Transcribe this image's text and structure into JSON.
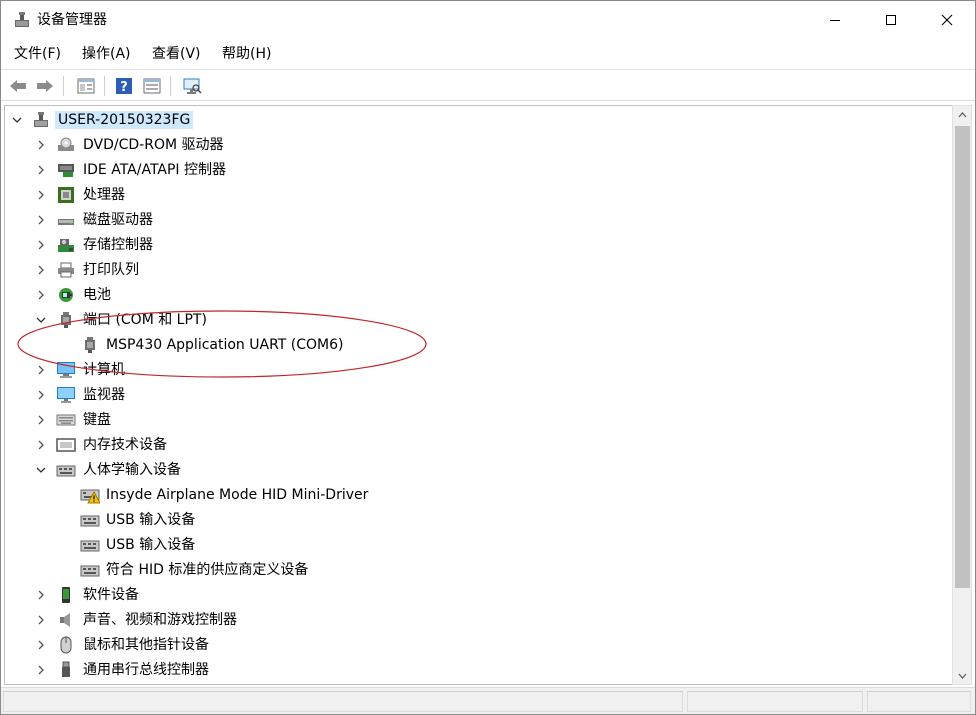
{
  "window": {
    "title": "设备管理器"
  },
  "menu": [
    {
      "name": "menu-file",
      "label": "文件(F)"
    },
    {
      "name": "menu-action",
      "label": "操作(A)"
    },
    {
      "name": "menu-view",
      "label": "查看(V)"
    },
    {
      "name": "menu-help",
      "label": "帮助(H)"
    }
  ],
  "tree": {
    "root": "USER-20150323FG",
    "items": [
      {
        "label": "DVD/CD-ROM 驱动器",
        "icon": "disc-drive-icon",
        "expanded": false
      },
      {
        "label": "IDE ATA/ATAPI 控制器",
        "icon": "ide-controller-icon",
        "expanded": false
      },
      {
        "label": "处理器",
        "icon": "processor-icon",
        "expanded": false
      },
      {
        "label": "磁盘驱动器",
        "icon": "disk-drive-icon",
        "expanded": false
      },
      {
        "label": "存储控制器",
        "icon": "storage-controller-icon",
        "expanded": false
      },
      {
        "label": "打印队列",
        "icon": "printer-icon",
        "expanded": false
      },
      {
        "label": "电池",
        "icon": "battery-icon",
        "expanded": false
      },
      {
        "label": "端口 (COM 和 LPT)",
        "icon": "port-icon",
        "expanded": true,
        "children": [
          {
            "label": "MSP430 Application UART (COM6)",
            "icon": "port-icon"
          }
        ]
      },
      {
        "label": "计算机",
        "icon": "computer-icon",
        "expanded": false
      },
      {
        "label": "监视器",
        "icon": "monitor-icon",
        "expanded": false
      },
      {
        "label": "键盘",
        "icon": "keyboard-icon",
        "expanded": false
      },
      {
        "label": "内存技术设备",
        "icon": "memory-device-icon",
        "expanded": false
      },
      {
        "label": "人体学输入设备",
        "icon": "hid-icon",
        "expanded": true,
        "children": [
          {
            "label": "Insyde Airplane Mode HID Mini-Driver",
            "icon": "hid-warning-icon"
          },
          {
            "label": "USB 输入设备",
            "icon": "hid-icon"
          },
          {
            "label": "USB 输入设备",
            "icon": "hid-icon"
          },
          {
            "label": "符合 HID 标准的供应商定义设备",
            "icon": "hid-icon"
          }
        ]
      },
      {
        "label": "软件设备",
        "icon": "software-device-icon",
        "expanded": false
      },
      {
        "label": "声音、视频和游戏控制器",
        "icon": "speaker-icon",
        "expanded": false
      },
      {
        "label": "鼠标和其他指针设备",
        "icon": "mouse-icon",
        "expanded": false
      },
      {
        "label": "通用串行总线控制器",
        "icon": "usb-icon",
        "expanded": false
      }
    ]
  },
  "colors": {
    "selection": "#cde8ff",
    "annotation": "#c0262d"
  }
}
